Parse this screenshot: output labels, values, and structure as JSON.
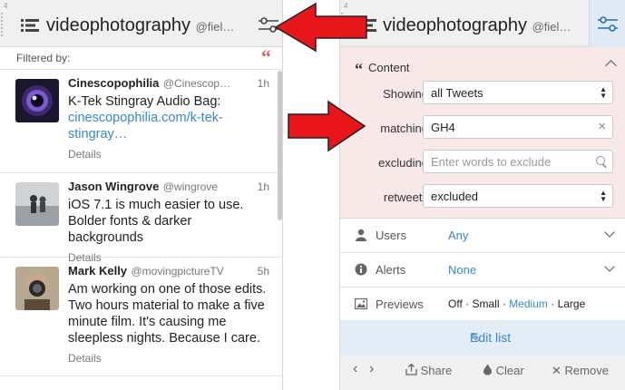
{
  "left_column": {
    "number": "4",
    "title": "videophotography",
    "handle": "@fiel…",
    "filtered_label": "Filtered by:",
    "tweets": [
      {
        "name": "Cinescopophilia",
        "handle": "@Cinescop…",
        "time": "1h",
        "text": "K-Tek Stingray Audio Bag:",
        "link": "cinescopophilia.com/k-tek-stingray…",
        "details": "Details"
      },
      {
        "name": "Jason Wingrove",
        "handle": "@wingrove",
        "time": "1h",
        "text": "iOS 7.1 is much easier to use. Bolder fonts & darker backgrounds",
        "details": "Details"
      },
      {
        "name": "Mark Kelly",
        "handle": "@movingpictureTV",
        "time": "5h",
        "text": "Am working on one of those edits. Two hours material to make a five minute film. It's causing me sleepless nights. Because I care.",
        "details": "Details"
      }
    ]
  },
  "right_column": {
    "number": "4",
    "title": "videophotography",
    "handle": "@fiel…",
    "content_section": {
      "heading": "Content",
      "showing_label": "Showing",
      "showing_value": "all Tweets",
      "matching_label": "matching",
      "matching_value": "GH4",
      "excluding_label": "excluding",
      "excluding_placeholder": "Enter words to exclude",
      "retweets_label": "retweets",
      "retweets_value": "excluded"
    },
    "users": {
      "label": "Users",
      "value": "Any"
    },
    "alerts": {
      "label": "Alerts",
      "value": "None"
    },
    "previews": {
      "label": "Previews",
      "options": [
        "Off",
        "Small",
        "Medium",
        "Large"
      ],
      "selected": "Medium",
      "sep": "·"
    },
    "edit_list": "Edit list",
    "footer": {
      "share": "Share",
      "clear": "Clear",
      "remove": "Remove"
    }
  },
  "colors": {
    "accent": "#3a87c8",
    "arrow": "#e8161b",
    "content_bg": "#f8e8e8",
    "edit_bg": "#e3edf7"
  }
}
